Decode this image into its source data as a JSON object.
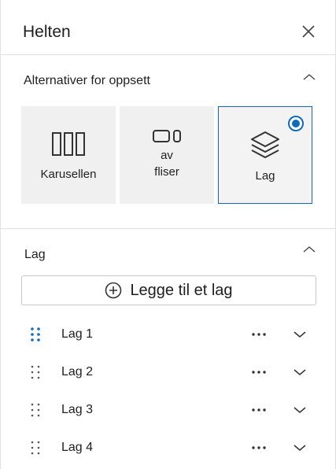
{
  "header": {
    "title": "Helten"
  },
  "layout_section": {
    "title": "Alternativer for oppsett",
    "options": [
      {
        "label": "Karusellen",
        "icon": "carousel-icon"
      },
      {
        "label": "av\nfliser",
        "icon": "tiles-icon"
      },
      {
        "label": "Lag",
        "icon": "layers-icon",
        "selected": true
      }
    ]
  },
  "layers_section": {
    "title": "Lag",
    "add_button": "Legge til et lag",
    "layers": [
      {
        "label": "Lag 1"
      },
      {
        "label": "Lag 2"
      },
      {
        "label": "Lag 3"
      },
      {
        "label": "Lag 4"
      }
    ]
  },
  "colors": {
    "accent": "#0f6cbd",
    "tile_bg": "#f0f0f0",
    "divider": "#e1e1e1"
  }
}
